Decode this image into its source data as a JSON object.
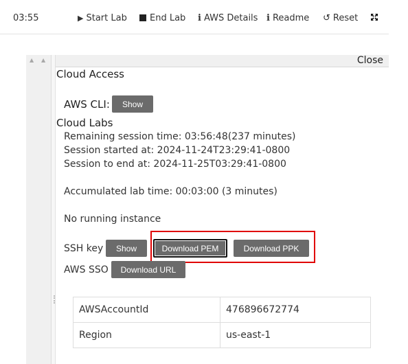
{
  "topbar": {
    "timer": "03:55",
    "start_lab": "Start Lab",
    "end_lab": "End Lab",
    "aws_details": "AWS Details",
    "readme": "Readme",
    "reset": "Reset"
  },
  "panel": {
    "close_label": "Close",
    "cloud_access_title": "Cloud Access",
    "aws_cli_label": "AWS CLI:",
    "show_label": "Show",
    "cloud_labs_title": "Cloud Labs",
    "remaining": "Remaining session time: 03:56:48(237 minutes)",
    "started": "Session started at: 2024-11-24T23:29:41-0800",
    "ends": "Session to end  at: 2024-11-25T03:29:41-0800",
    "accumulated": "Accumulated lab time: 00:03:00 (3 minutes)",
    "no_instance": "No running instance",
    "ssh_key_label": "SSH key",
    "ssh_show_label": "Show",
    "download_pem": "Download PEM",
    "download_ppk": "Download PPK",
    "aws_sso_label": "AWS SSO",
    "download_url": "Download URL"
  },
  "account_table": [
    {
      "key": "AWSAccountId",
      "value": "476896672774"
    },
    {
      "key": "Region",
      "value": "us-east-1"
    }
  ],
  "colors": {
    "button_bg": "#6b6b6b",
    "highlight": "#e00000",
    "header_bg": "#f0f0f0"
  }
}
